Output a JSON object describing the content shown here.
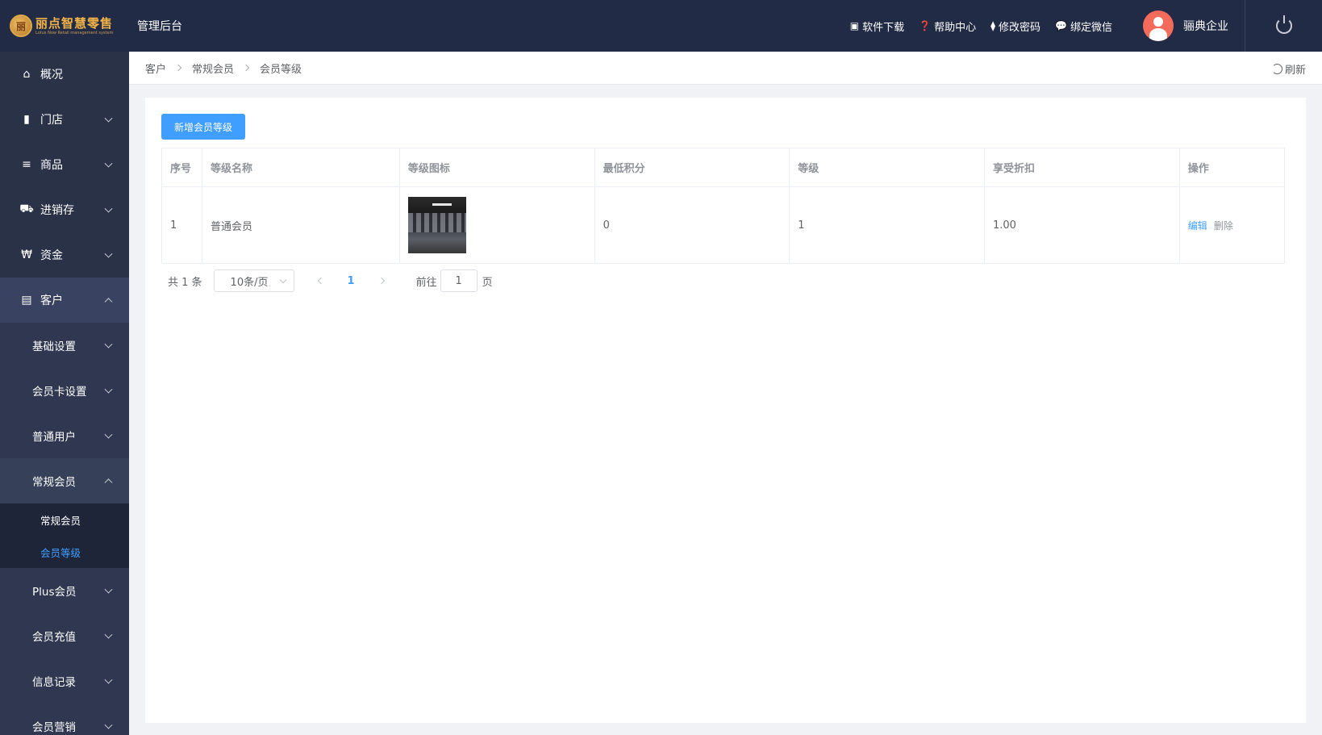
{
  "header": {
    "logo_title": "丽点智慧零售",
    "logo_subtitle": "Lotus Now Retail management system",
    "admin_title": "管理后台",
    "links": [
      {
        "label": "软件下载",
        "icon": "store-icon"
      },
      {
        "label": "帮助中心",
        "icon": "help-icon"
      },
      {
        "label": "修改密码",
        "icon": "thermometer-icon"
      },
      {
        "label": "绑定微信",
        "icon": "wechat-icon"
      }
    ],
    "username": "骊典企业"
  },
  "sidebar": {
    "items": [
      {
        "label": "概况",
        "icon": "home-icon"
      },
      {
        "label": "门店",
        "icon": "building-icon"
      },
      {
        "label": "商品",
        "icon": "list-icon"
      },
      {
        "label": "进销存",
        "icon": "truck-icon"
      },
      {
        "label": "资金",
        "icon": "won-icon"
      },
      {
        "label": "客户",
        "icon": "id-card-icon"
      }
    ],
    "customer_sub": [
      {
        "label": "基础设置"
      },
      {
        "label": "会员卡设置"
      },
      {
        "label": "普通用户"
      },
      {
        "label": "常规会员"
      }
    ],
    "regular_member_leaves": [
      {
        "label": "常规会员"
      },
      {
        "label": "会员等级"
      }
    ],
    "after_sub": [
      {
        "label": "Plus会员"
      },
      {
        "label": "会员充值"
      },
      {
        "label": "信息记录"
      },
      {
        "label": "会员营销"
      }
    ]
  },
  "breadcrumb": {
    "items": [
      "客户",
      "常规会员",
      "会员等级"
    ],
    "refresh_label": "刷新"
  },
  "main": {
    "add_button": "新增会员等级",
    "columns": [
      "序号",
      "等级名称",
      "等级图标",
      "最低积分",
      "等级",
      "享受折扣",
      "操作"
    ],
    "rows": [
      {
        "index": "1",
        "name": "普通会员",
        "min_points": "0",
        "level": "1",
        "discount": "1.00",
        "edit": "编辑",
        "delete": "删除"
      }
    ]
  },
  "pager": {
    "total": "共 1 条",
    "page_size": "10条/页",
    "current_page": "1",
    "goto_prefix": "前往",
    "goto_value": "1",
    "goto_suffix": "页"
  },
  "colors": {
    "topbar": "#222b45",
    "sidebar": "#2a3248",
    "accent": "#409eff"
  }
}
